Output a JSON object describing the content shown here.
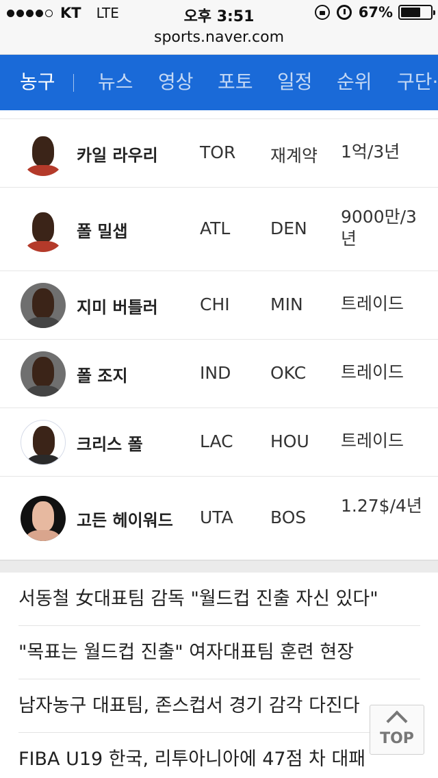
{
  "status_bar": {
    "carrier": "KT",
    "network": "LTE",
    "time": "오후 3:51",
    "battery_percent": "67%",
    "battery_level": 0.67
  },
  "url": "sports.naver.com",
  "nav": {
    "items": [
      "농구",
      "뉴스",
      "영상",
      "포토",
      "일정",
      "순위",
      "구단·"
    ],
    "active": "농구"
  },
  "transfers": [
    {
      "player": "카일 라우리",
      "from": "TOR",
      "to": "재계약",
      "deal": "1억/3년"
    },
    {
      "player": "폴 밀샙",
      "from": "ATL",
      "to": "DEN",
      "deal": "9000만/3년"
    },
    {
      "player": "지미 버틀러",
      "from": "CHI",
      "to": "MIN",
      "deal": "트레이드"
    },
    {
      "player": "폴 조지",
      "from": "IND",
      "to": "OKC",
      "deal": "트레이드"
    },
    {
      "player": "크리스 폴",
      "from": "LAC",
      "to": "HOU",
      "deal": "트레이드"
    },
    {
      "player": "고든 헤이워드",
      "from": "UTA",
      "to": "BOS",
      "deal": "1.27$/4년"
    }
  ],
  "news": [
    "서동철 女대표팀 감독 \"월드컵 진출 자신 있다\"",
    "\"목표는 월드컵 진출\" 여자대표팀 훈련 현장",
    "남자농구 대표팀, 존스컵서 경기 감각 다진다",
    "FIBA U19 한국, 리투아니아에 47점 차 대패"
  ],
  "top_button": "TOP"
}
